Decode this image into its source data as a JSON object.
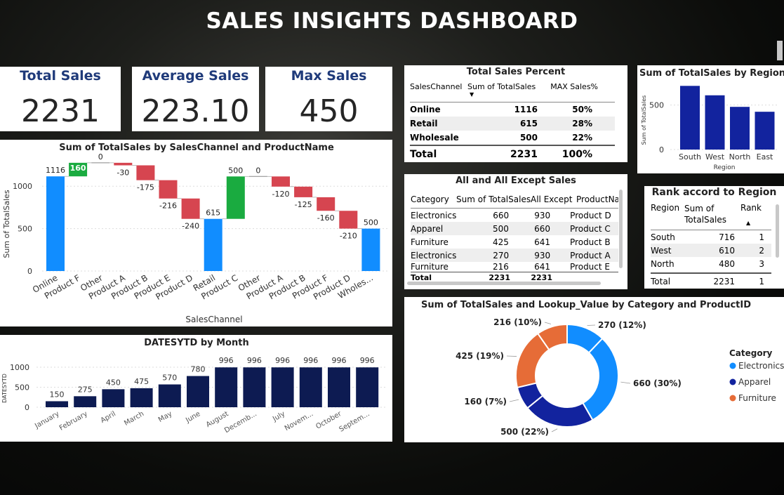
{
  "header": {
    "title": "SALES INSIGHTS DASHBOARD"
  },
  "kpis": [
    {
      "label": "Total Sales",
      "value": "2231"
    },
    {
      "label": "Average Sales",
      "value": "223.10"
    },
    {
      "label": "Max Sales",
      "value": "450"
    }
  ],
  "colors": {
    "blue": "#118dff",
    "green": "#1aab40",
    "red": "#d64550",
    "navy": "#12239e",
    "darknavy": "#0d1b52",
    "orange": "#e66c37"
  },
  "chart_data": [
    {
      "type": "bar",
      "subtype": "waterfall",
      "title": "Sum of TotalSales by SalesChannel and ProductName",
      "xlabel": "SalesChannel",
      "ylabel": "Sum of TotalSales",
      "ylim": [
        0,
        1250
      ],
      "yticks": [
        0,
        500,
        1000
      ],
      "categories": [
        "Online",
        "Product F",
        "Other",
        "Product A",
        "Product B",
        "Product E",
        "Product D",
        "Retail",
        "Product C",
        "Other",
        "Product A",
        "Product B",
        "Product F",
        "Product D",
        "Wholes..."
      ],
      "values": [
        1116,
        160,
        0,
        -30,
        -175,
        -216,
        -240,
        615,
        500,
        0,
        -120,
        -125,
        -160,
        -210,
        500
      ],
      "labels": [
        "1116",
        "160",
        "0",
        "-30",
        "-175",
        "-216",
        "-240",
        "615",
        "500",
        "0",
        "-120",
        "-125",
        "-160",
        "-210",
        "500"
      ],
      "kinds": [
        "total",
        "up",
        "flat",
        "down",
        "down",
        "down",
        "down",
        "total",
        "up",
        "flat",
        "down",
        "down",
        "down",
        "down",
        "total"
      ]
    },
    {
      "type": "bar",
      "title": "DATESYTD by Month",
      "ylabel": "DATESYTD",
      "ylim": [
        0,
        1000
      ],
      "yticks": [
        0,
        500,
        1000
      ],
      "categories": [
        "January",
        "February",
        "April",
        "March",
        "May",
        "June",
        "August",
        "Decemb...",
        "July",
        "Novem...",
        "October",
        "Septem..."
      ],
      "values": [
        150,
        275,
        450,
        475,
        570,
        780,
        996,
        996,
        996,
        996,
        996,
        996
      ]
    },
    {
      "type": "bar",
      "title": "Sum of TotalSales by Region",
      "xlabel": "Region",
      "ylabel": "Sum of TotalSales",
      "ylim": [
        0,
        750
      ],
      "yticks": [
        0,
        500
      ],
      "categories": [
        "South",
        "West",
        "North",
        "East"
      ],
      "values": [
        716,
        610,
        480,
        425
      ]
    },
    {
      "type": "pie",
      "subtype": "donut",
      "title": "Sum of TotalSales and Lookup_Value by Category and ProductID",
      "legend_title": "Category",
      "legend": [
        "Electronics",
        "Apparel",
        "Furniture"
      ],
      "slices": [
        {
          "category": "Electronics",
          "value": 270,
          "label": "270 (12%)"
        },
        {
          "category": "Electronics",
          "value": 660,
          "label": "660 (30%)"
        },
        {
          "category": "Apparel",
          "value": 500,
          "label": "500 (22%)"
        },
        {
          "category": "Apparel",
          "value": 160,
          "label": "160 (7%)"
        },
        {
          "category": "Furniture",
          "value": 425,
          "label": "425 (19%)"
        },
        {
          "category": "Furniture",
          "value": 216,
          "label": "216 (10%)"
        }
      ]
    }
  ],
  "tables": {
    "percent": {
      "title": "Total Sales Percent",
      "headers": [
        "SalesChannel",
        "Sum of TotalSales",
        "MAX Sales%"
      ],
      "rows": [
        [
          "Online",
          "1116",
          "50%"
        ],
        [
          "Retail",
          "615",
          "28%"
        ],
        [
          "Wholesale",
          "500",
          "22%"
        ]
      ],
      "total": [
        "Total",
        "2231",
        "100%"
      ]
    },
    "except": {
      "title": "All and All Except Sales",
      "headers": [
        "Category",
        "Sum of TotalSales",
        "All Except",
        "ProductNa"
      ],
      "rows": [
        [
          "Electronics",
          "660",
          "930",
          "Product D"
        ],
        [
          "Apparel",
          "500",
          "660",
          "Product C"
        ],
        [
          "Furniture",
          "425",
          "641",
          "Product B"
        ],
        [
          "Electronics",
          "270",
          "930",
          "Product A"
        ],
        [
          "Furniture",
          "216",
          "641",
          "Product E"
        ]
      ],
      "total": [
        "Total",
        "2231",
        "2231",
        ""
      ]
    },
    "rank": {
      "title": "Rank accord to Region",
      "headers": [
        "Region",
        "Sum of TotalSales",
        "Rank"
      ],
      "rows": [
        [
          "South",
          "716",
          "1"
        ],
        [
          "West",
          "610",
          "2"
        ],
        [
          "North",
          "480",
          "3"
        ]
      ],
      "total": [
        "Total",
        "2231",
        "1"
      ]
    }
  }
}
